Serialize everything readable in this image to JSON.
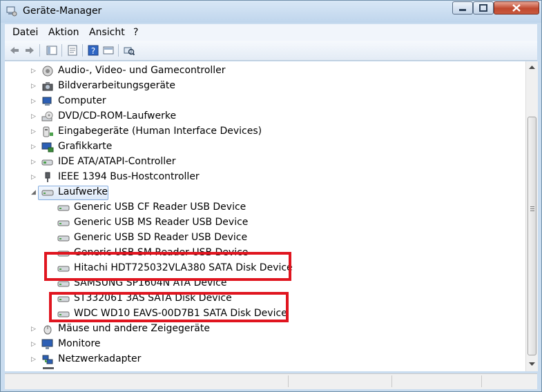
{
  "window": {
    "title": "Geräte-Manager"
  },
  "menu": {
    "items": [
      "Datei",
      "Aktion",
      "Ansicht",
      "?"
    ]
  },
  "toolbar": {
    "buttons": [
      "back-icon",
      "forward-icon",
      "show-hide-tree-icon",
      "properties-icon",
      "help-icon",
      "view-icon",
      "scan-hardware-icon"
    ]
  },
  "tree": {
    "categories_top": [
      {
        "label": "Audio-, Video- und Gamecontroller",
        "icon": "speaker-icon",
        "expanded": false
      },
      {
        "label": "Bildverarbeitungsgeräte",
        "icon": "camera-icon",
        "expanded": false
      },
      {
        "label": "Computer",
        "icon": "computer-icon",
        "expanded": false
      },
      {
        "label": "DVD/CD-ROM-Laufwerke",
        "icon": "dvd-drive-icon",
        "expanded": false
      },
      {
        "label": "Eingabegeräte (Human Interface Devices)",
        "icon": "hid-icon",
        "expanded": false
      },
      {
        "label": "Grafikkarte",
        "icon": "display-adapter-icon",
        "expanded": false
      },
      {
        "label": "IDE ATA/ATAPI-Controller",
        "icon": "ide-controller-icon",
        "expanded": false
      },
      {
        "label": "IEEE 1394 Bus-Hostcontroller",
        "icon": "firewire-icon",
        "expanded": false
      }
    ],
    "disk_category": {
      "label": "Laufwerke",
      "icon": "disk-drive-icon",
      "expanded": true,
      "selected": true
    },
    "disk_devices": [
      {
        "label": "Generic USB CF Reader USB Device",
        "highlighted": false
      },
      {
        "label": "Generic USB MS Reader USB Device",
        "highlighted": false
      },
      {
        "label": "Generic USB SD Reader USB Device",
        "highlighted": false
      },
      {
        "label": "Generic USB SM Reader USB Device",
        "highlighted": false
      },
      {
        "label": "Hitachi HDT725032VLA380 SATA Disk Device",
        "highlighted": true
      },
      {
        "label": "SAMSUNG SP1604N ATA Device",
        "highlighted": false
      },
      {
        "label": "ST332061 3AS SATA Disk Device",
        "highlighted": true
      },
      {
        "label": "WDC WD10 EAVS-00D7B1 SATA Disk Device",
        "highlighted": true
      }
    ],
    "categories_bottom": [
      {
        "label": "Mäuse und andere Zeigegeräte",
        "icon": "mouse-icon",
        "expanded": false
      },
      {
        "label": "Monitore",
        "icon": "monitor-icon",
        "expanded": false
      },
      {
        "label": "Netzwerkadapter",
        "icon": "network-adapter-icon",
        "expanded": false
      }
    ]
  },
  "colors": {
    "highlight_box": "#e0151f",
    "selection": "#dde9f8"
  }
}
